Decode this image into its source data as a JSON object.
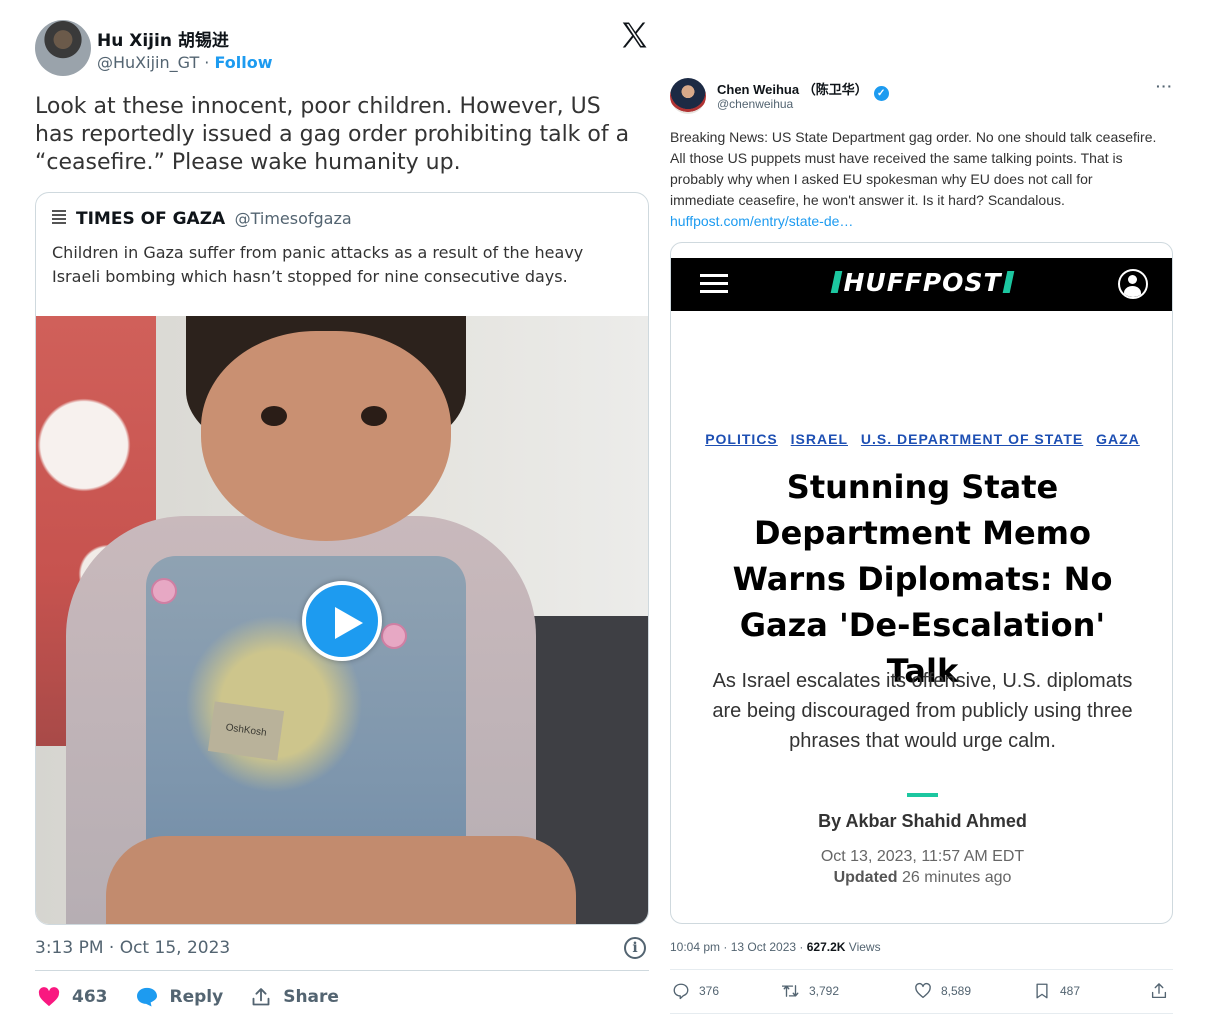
{
  "left_tweet": {
    "author_name": "Hu Xijin 胡锡进",
    "author_handle": "@HuXijin_GT",
    "separator": " · ",
    "follow_label": "Follow",
    "text": "Look at these innocent, poor children. However, US has reportedly issued a gag order prohibiting talk of a “ceasefire.” Please wake humanity up.",
    "quote": {
      "source_name": "TIMES OF GAZA",
      "source_handle": "@Timesofgaza",
      "text": "Children in Gaza suffer from panic attacks as a result of the heavy Israeli bombing which hasn’t stopped for nine consecutive days.",
      "media": {
        "play_icon": "play-icon",
        "overalls_label": "OshKosh"
      }
    },
    "timestamp": "3:13 PM · Oct 15, 2023",
    "info_icon": "i",
    "actions": {
      "likes": "463",
      "reply_label": "Reply",
      "share_label": "Share"
    },
    "colors": {
      "like": "#f91880",
      "reply": "#1d9bf0",
      "follow": "#1d9bf0"
    }
  },
  "right_tweet": {
    "author_name": "Chen Weihua （陈卫华）",
    "author_handle": "@chenweihua",
    "more": "···",
    "text": "Breaking News: US State Department gag order. No one should talk ceasefire.  All those US puppets must have received the same talking points. That is probably why when I asked EU spokesman why EU does not call for immediate ceasefire, he won't answer it. Is it hard? Scandalous. ",
    "link": "huffpost.com/entry/state-de…",
    "card": {
      "logo_left": "HUFFPOST",
      "tags": [
        "POLITICS",
        "ISRAEL",
        "U.S. DEPARTMENT OF STATE",
        "GAZA"
      ],
      "headline": "Stunning State Department Memo Warns Diplomats: No Gaza 'De-Escalation' Talk",
      "dek": "As Israel escalates its offensive, U.S. diplomats are being discouraged from publicly using three phrases that would urge calm.",
      "byline": "By Akbar Shahid Ahmed",
      "date": "Oct 13, 2023, 11:57 AM EDT",
      "updated_label": "Updated",
      "updated_value": " 26 minutes ago"
    },
    "meta_time": "10:04 pm · 13 Oct 2023 · ",
    "meta_views": "627.2K",
    "meta_views_label": " Views",
    "stats": {
      "replies": "376",
      "retweets": "3,792",
      "likes": "8,589",
      "bookmarks": "487"
    }
  }
}
